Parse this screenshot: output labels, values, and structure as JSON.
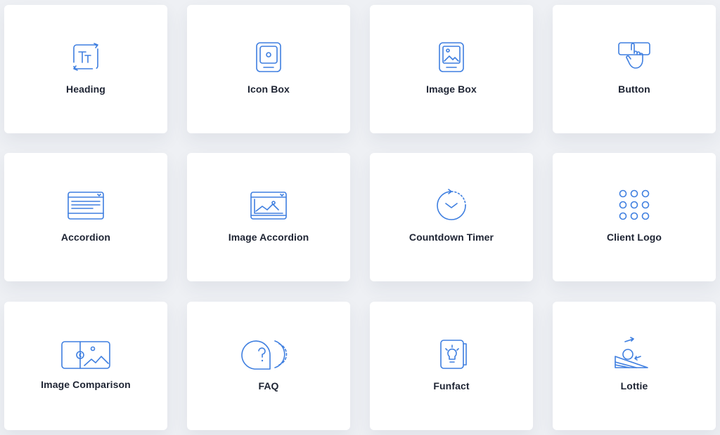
{
  "widgets": [
    {
      "label": "Heading",
      "icon": "heading-icon"
    },
    {
      "label": "Icon Box",
      "icon": "icon-box-icon"
    },
    {
      "label": "Image Box",
      "icon": "image-box-icon"
    },
    {
      "label": "Button",
      "icon": "button-click-icon"
    },
    {
      "label": "Accordion",
      "icon": "accordion-icon"
    },
    {
      "label": "Image Accordion",
      "icon": "image-accordion-icon"
    },
    {
      "label": "Countdown Timer",
      "icon": "countdown-timer-icon"
    },
    {
      "label": "Client Logo",
      "icon": "client-logo-grid-icon"
    },
    {
      "label": "Image Comparison",
      "icon": "image-comparison-icon"
    },
    {
      "label": "FAQ",
      "icon": "faq-icon"
    },
    {
      "label": "Funfact",
      "icon": "funfact-icon"
    },
    {
      "label": "Lottie",
      "icon": "lottie-icon"
    }
  ],
  "colors": {
    "accent": "#3f7fe0",
    "card_background": "#ffffff",
    "page_background": "#eef0f4",
    "label_text": "#1e2433"
  }
}
